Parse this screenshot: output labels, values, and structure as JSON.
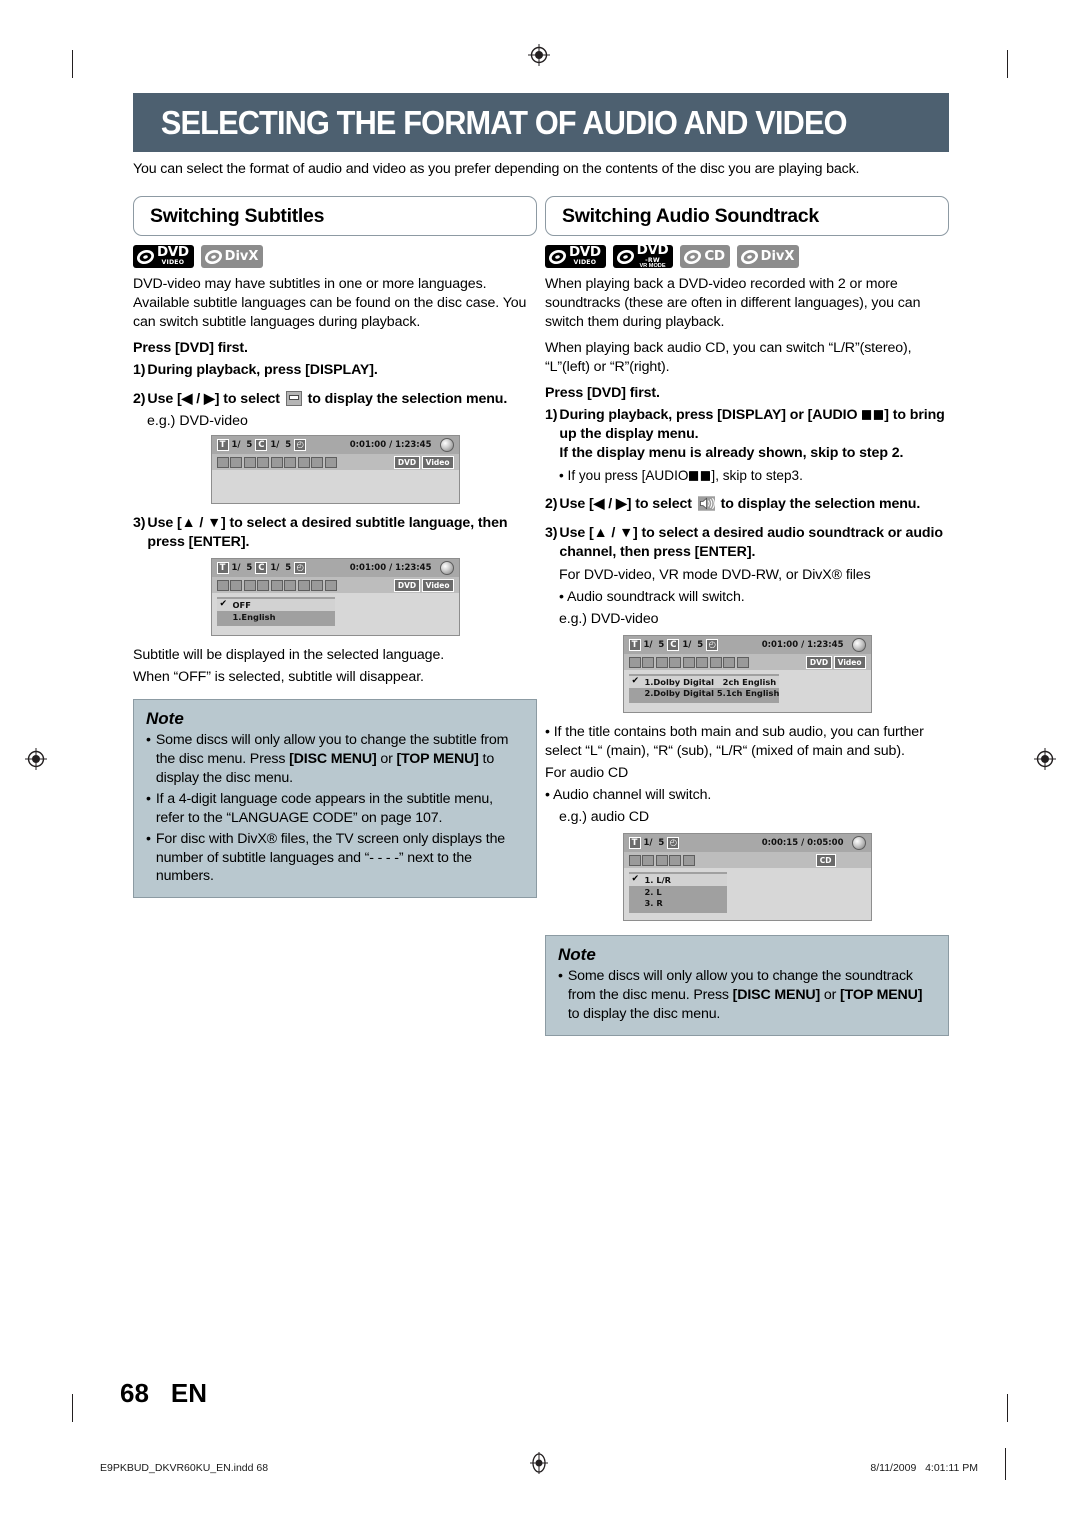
{
  "header": {
    "title": "SELECTING THE FORMAT OF AUDIO AND VIDEO",
    "intro": "You can select the format of audio and video as you prefer depending on the contents of the disc you are playing back.",
    "banner_color": "#4d6070"
  },
  "left": {
    "section_title": "Switching Subtitles",
    "badges": [
      {
        "name": "dvd-video-logo",
        "main": "DVD",
        "sub": "VIDEO",
        "style": "dark"
      },
      {
        "name": "divx-logo",
        "main": "DivX",
        "sub": "",
        "style": "grey"
      }
    ],
    "intro": "DVD-video may have subtitles in one or more languages. Available subtitle languages can be found on the disc case. You can switch subtitle languages during playback.",
    "press_first": "Press [DVD] first.",
    "step1_num": "1)",
    "step1_text": "During playback, press [DISPLAY].",
    "step2_num": "2)",
    "step2_a": "Use [",
    "step2_b": " / ",
    "step2_c": "] to select",
    "step2_d": "to display the selection menu.",
    "eg1": "e.g.) DVD-video",
    "step3_num": "3)",
    "step3_text": "Use [▲ / ▼] to select a desired subtitle language, then press [ENTER].",
    "after_text_1": "Subtitle will be displayed in the selected language.",
    "after_text_2": "When “OFF” is selected, subtitle will disappear.",
    "screen1": {
      "title_label": "T",
      "title_value": "1/  5",
      "chapter_label": "C",
      "chapter_value": "1/  5",
      "clock_label": "◴",
      "time": "0:01:00 / 1:23:45",
      "tag1": "DVD",
      "tag2": "Video",
      "menu": []
    },
    "screen2": {
      "title_label": "T",
      "title_value": "1/  5",
      "chapter_label": "C",
      "chapter_value": "1/  5",
      "clock_label": "◴",
      "time": "0:01:00 / 1:23:45",
      "tag1": "DVD",
      "tag2": "Video",
      "menu": [
        {
          "label": "OFF",
          "selected": true
        },
        {
          "label": "1.English",
          "selected": false
        }
      ]
    },
    "note": {
      "title": "Note",
      "items": [
        "Some discs will only allow you to change the subtitle from the disc menu. Press [DISC MENU] or [TOP MENU] to display the disc menu.",
        "If a 4-digit language code appears in the subtitle menu, refer to the “LANGUAGE CODE” on page 107.",
        "For disc with DivX® files, the TV screen only displays the number of subtitle languages and “- - - -” next to the numbers."
      ]
    }
  },
  "right": {
    "section_title": "Switching Audio Soundtrack",
    "badges": [
      {
        "name": "dvd-video-logo",
        "main": "DVD",
        "sub": "VIDEO",
        "style": "dark"
      },
      {
        "name": "dvd-rw-vr-mode-logo",
        "main": "DVD",
        "sub": "-RW",
        "sub2": "VR MODE",
        "style": "dark"
      },
      {
        "name": "cd-logo",
        "main": "CD",
        "sub": "",
        "style": "grey"
      },
      {
        "name": "divx-logo",
        "main": "DivX",
        "sub": "",
        "style": "grey"
      }
    ],
    "intro_1": "When playing back a DVD-video recorded with 2 or more soundtracks (these are often in different languages), you can switch them during playback.",
    "intro_2": "When playing back audio CD, you can switch “L/R”(stereo), “L”(left) or “R”(right).",
    "press_first": "Press [DVD] first.",
    "step1_num": "1)",
    "step1_a": "During playback, press [DISPLAY] or [AUDIO",
    "step1_b": "] to bring up the display menu.",
    "step1_c": "If the display menu is already shown, skip to step 2.",
    "step1_bullet_a": "If you press [AUDIO",
    "step1_bullet_b": "], skip to step3.",
    "step2_num": "2)",
    "step2_a": "Use [",
    "step2_b": " / ",
    "step2_c": "] to select",
    "step2_d": "to display the selection menu.",
    "step3_num": "3)",
    "step3_text": "Use [▲ / ▼] to select a desired audio soundtrack or audio channel, then press [ENTER].",
    "for_dvd": "For DVD-video, VR mode DVD-RW, or DivX® files",
    "bullet_soundtrack": "Audio soundtrack will switch.",
    "eg_dvd": "e.g.) DVD-video",
    "bullet_main_sub": "If the title contains both main and sub audio, you can further select “L“ (main), “R“ (sub), “L/R“ (mixed of main and sub).",
    "for_cd": "For audio CD",
    "bullet_channel": "Audio channel will switch.",
    "eg_cd": "e.g.) audio CD",
    "screen1": {
      "title_label": "T",
      "title_value": "1/  5",
      "chapter_label": "C",
      "chapter_value": "1/  5",
      "clock_label": "◴",
      "time": "0:01:00 / 1:23:45",
      "tag1": "DVD",
      "tag2": "Video",
      "menu": [
        {
          "label": "1.Dolby Digital   2ch English",
          "selected": true
        },
        {
          "label": "2.Dolby Digital 5.1ch English",
          "selected": false
        }
      ]
    },
    "screen2": {
      "title_label": "T",
      "title_value": "1/  5",
      "chapter_label": "",
      "chapter_value": "",
      "clock_label": "◴",
      "time": "0:00:15 / 0:05:00",
      "tag1": "CD",
      "tag2": "",
      "menu": [
        {
          "label": "1. L/R",
          "selected": true
        },
        {
          "label": "2. L",
          "selected": false
        },
        {
          "label": "3. R",
          "selected": false
        }
      ]
    },
    "note": {
      "title": "Note",
      "items": [
        "Some discs will only allow you to change the soundtrack from the disc menu. Press [DISC MENU] or [TOP MENU] to display the disc menu."
      ]
    }
  },
  "footer": {
    "page_number": "68",
    "language_code": "EN",
    "file_name": "E9PKBUD_DKVR60KU_EN.indd   68",
    "timestamp": "8/11/2009   4:01:11 PM"
  }
}
